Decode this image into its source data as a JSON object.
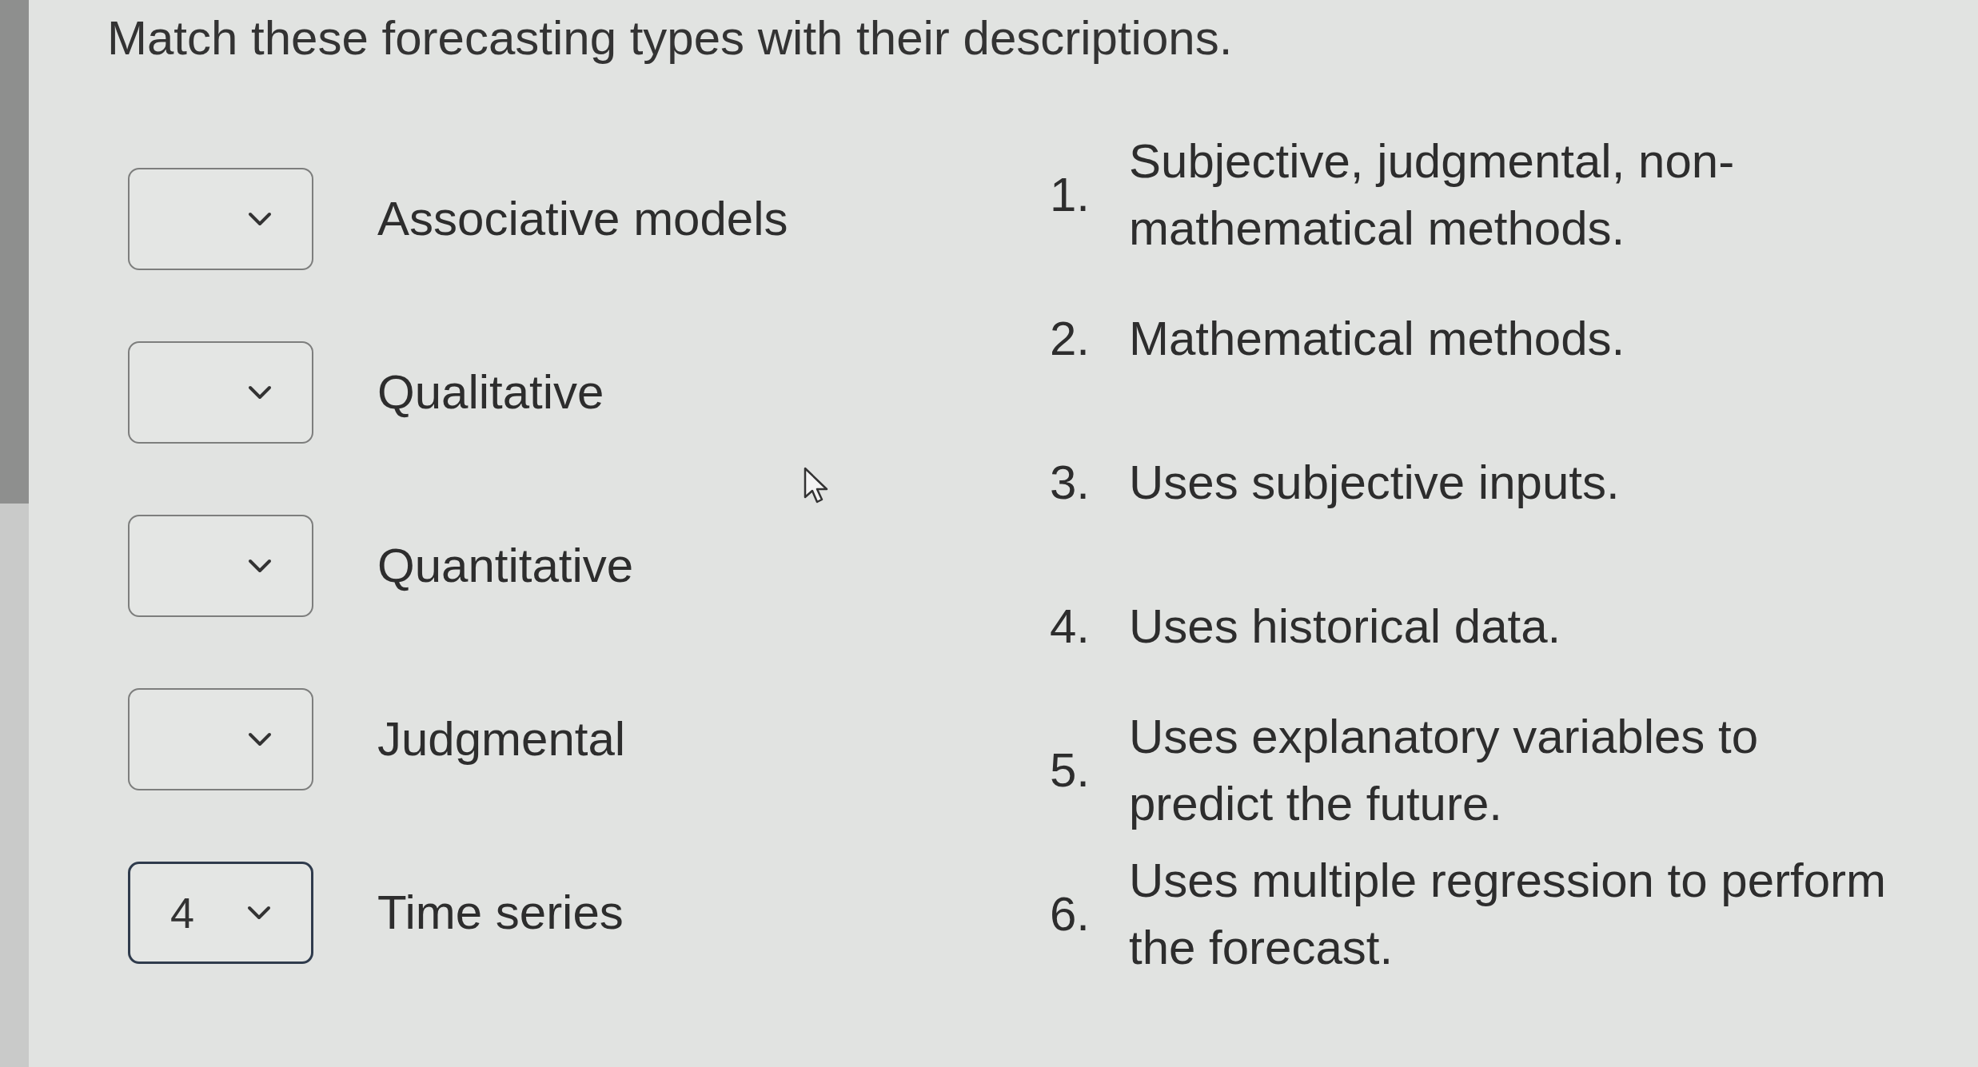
{
  "question": {
    "prompt": "Match these forecasting types with their descriptions."
  },
  "matches": [
    {
      "term": "Associative models",
      "focused": false
    },
    {
      "term": "Qualitative",
      "focused": false
    },
    {
      "term": "Quantitative",
      "focused": false
    },
    {
      "term": "Judgmental",
      "focused": false
    },
    {
      "term": "Time series",
      "value": "4",
      "focused": true
    }
  ],
  "descriptions": [
    {
      "number": "1.",
      "lines": [
        "Subjective, judgmental, non-",
        "mathematical methods."
      ]
    },
    {
      "number": "2.",
      "lines": [
        "Mathematical methods."
      ]
    },
    {
      "number": "3.",
      "lines": [
        "Uses subjective inputs."
      ]
    },
    {
      "number": "4.",
      "lines": [
        "Uses historical data."
      ]
    },
    {
      "number": "5.",
      "lines": [
        "Uses explanatory variables to",
        "predict the future."
      ]
    },
    {
      "number": "6.",
      "lines": [
        "Uses multiple regression to perform",
        "the forecast."
      ]
    }
  ]
}
